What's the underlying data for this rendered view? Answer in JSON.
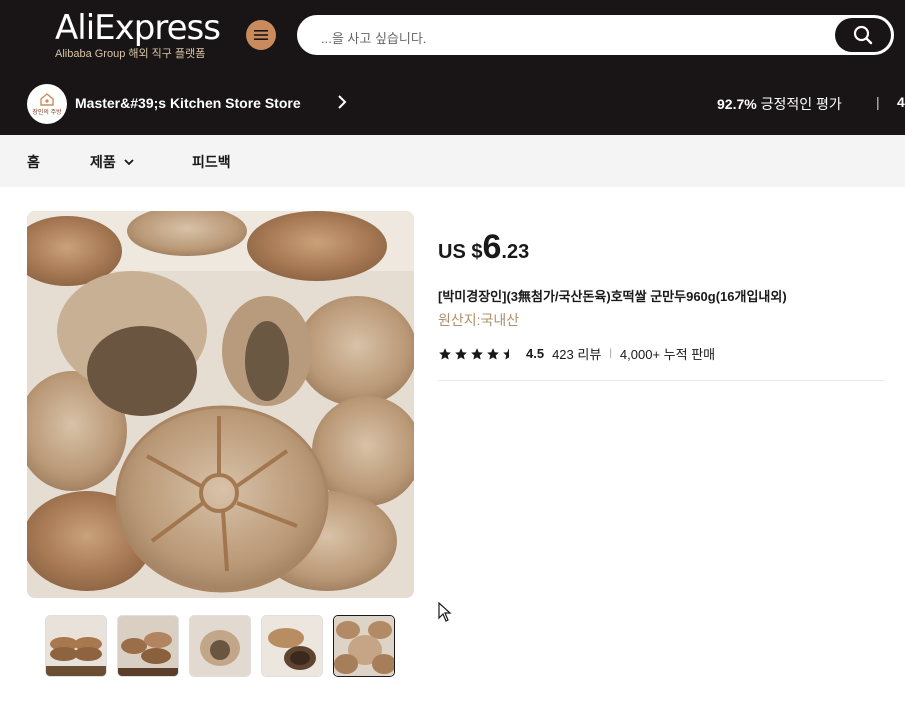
{
  "header": {
    "logo": "AliExpress",
    "logo_sub": "Alibaba Group 해외 직구 플랫폼",
    "search_placeholder": "...을 사고 싶습니다."
  },
  "store": {
    "avatar_text": "장인의 주방",
    "name": "Master&#39;s Kitchen Store Store",
    "rating_value": "92.7%",
    "rating_label": " 긍정적인 평가",
    "separator": "|",
    "next_value": "4"
  },
  "nav": {
    "home": "홈",
    "products": "제품",
    "feedback": "피드백"
  },
  "product": {
    "price_currency": "US $",
    "price_int": "6",
    "price_dec": ".23",
    "title": "[박미경장인](3無첨가/국산돈육)호떡쌀 군만두960g(16개입내외)",
    "origin": "원산지:국내산",
    "rating": "4.5",
    "reviews": "423 리뷰",
    "sold": "4,000+ 누적 판매",
    "stars": 4.5
  },
  "gallery": {
    "thumb_count": 5,
    "active_index": 4
  },
  "colors": {
    "header_bg": "#191516",
    "accent": "#c98b5c",
    "origin_text": "#b0906c"
  }
}
